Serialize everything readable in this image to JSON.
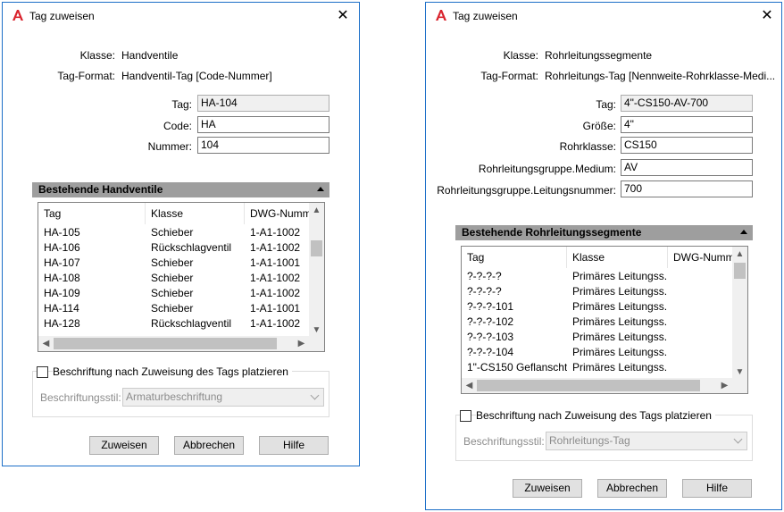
{
  "dialog1": {
    "title": "Tag zuweisen",
    "klasse_label": "Klasse:",
    "klasse_value": "Handventile",
    "tagformat_label": "Tag-Format:",
    "tagformat_value": "Handventil-Tag [Code-Nummer]",
    "fields": [
      {
        "label": "Tag:",
        "value": "HA-104",
        "readonly": true
      },
      {
        "label": "Code:",
        "value": "HA"
      },
      {
        "label": "Nummer:",
        "value": "104"
      }
    ],
    "section_title": "Bestehende Handventile",
    "columns": [
      "Tag",
      "Klasse",
      "DWG-Nummer"
    ],
    "rows": [
      [
        "HA-105",
        "Schieber",
        "1-A1-1002"
      ],
      [
        "HA-106",
        "Rückschlagventil",
        "1-A1-1002"
      ],
      [
        "HA-107",
        "Schieber",
        "1-A1-1001"
      ],
      [
        "HA-108",
        "Schieber",
        "1-A1-1002"
      ],
      [
        "HA-109",
        "Schieber",
        "1-A1-1002"
      ],
      [
        "HA-114",
        "Schieber",
        "1-A1-1001"
      ],
      [
        "HA-128",
        "Rückschlagventil",
        "1-A1-1002"
      ]
    ],
    "checkbox_label": "Beschriftung nach Zuweisung des Tags platzieren",
    "style_label": "Beschriftungsstil:",
    "style_value": "Armaturbeschriftung",
    "buttons": {
      "assign": "Zuweisen",
      "cancel": "Abbrechen",
      "help": "Hilfe"
    }
  },
  "dialog2": {
    "title": "Tag zuweisen",
    "klasse_label": "Klasse:",
    "klasse_value": "Rohrleitungssegmente",
    "tagformat_label": "Tag-Format:",
    "tagformat_value": "Rohrleitungs-Tag [Nennweite-Rohrklasse-Medi...",
    "fields": [
      {
        "label": "Tag:",
        "value": "4\"-CS150-AV-700",
        "readonly": true
      },
      {
        "label": "Größe:",
        "value": "4\""
      },
      {
        "label": "Rohrklasse:",
        "value": "CS150"
      },
      {
        "label": "Rohrleitungsgruppe.Medium:",
        "value": "AV"
      },
      {
        "label": "Rohrleitungsgruppe.Leitungsnummer:",
        "value": "700"
      }
    ],
    "section_title": "Bestehende Rohrleitungssegmente",
    "columns": [
      "Tag",
      "Klasse",
      "DWG-Nummer"
    ],
    "rows": [
      [
        "?-?-?-?",
        "Primäres Leitungss...",
        ""
      ],
      [
        "?-?-?-?",
        "Primäres Leitungss...",
        ""
      ],
      [
        "?-?-?-101",
        "Primäres Leitungss...",
        ""
      ],
      [
        "?-?-?-102",
        "Primäres Leitungss...",
        ""
      ],
      [
        "?-?-?-103",
        "Primäres Leitungss...",
        ""
      ],
      [
        "?-?-?-104",
        "Primäres Leitungss...",
        ""
      ],
      [
        "1\"-CS150 Geflanscht...",
        "Primäres Leitungss...",
        ""
      ]
    ],
    "checkbox_label": "Beschriftung nach Zuweisung des Tags platzieren",
    "style_label": "Beschriftungsstil:",
    "style_value": "Rohrleitungs-Tag",
    "buttons": {
      "assign": "Zuweisen",
      "cancel": "Abbrechen",
      "help": "Hilfe"
    }
  },
  "colors": {
    "accent": "#1c6fc8",
    "section": "#9e9e9e",
    "app_icon": "#d9232d"
  },
  "icons": {
    "app": "autocad-a-icon",
    "close": "close-icon"
  }
}
